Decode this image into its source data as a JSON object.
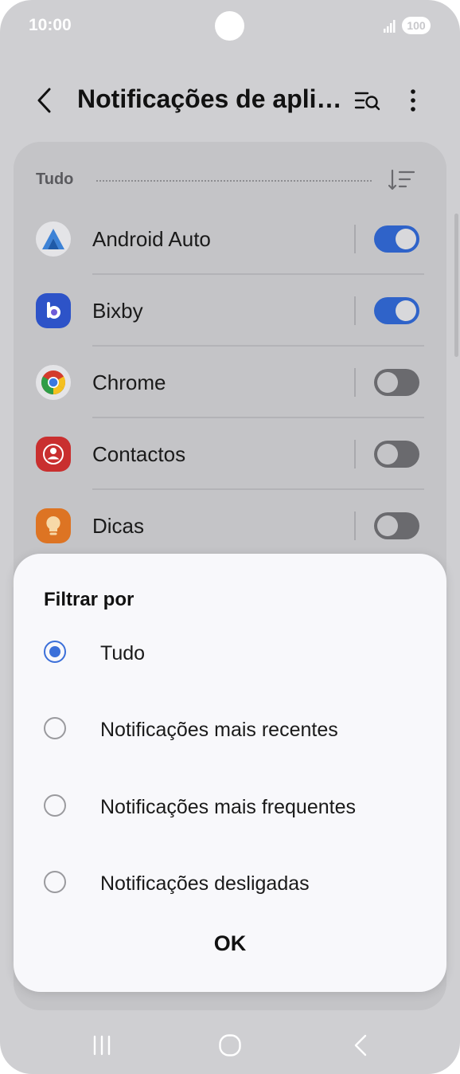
{
  "status_bar": {
    "time": "10:00",
    "battery": "100",
    "signal_icon": "signal-icon"
  },
  "app_bar": {
    "title": "Notificações de aplicações",
    "back_icon": "back-icon",
    "search_icon": "search-filter-icon",
    "more_icon": "more-options-icon"
  },
  "list": {
    "filter_label": "Tudo",
    "sort_icon": "sort-icon",
    "apps": [
      {
        "name": "Android Auto",
        "icon": "android-auto-icon",
        "enabled": true
      },
      {
        "name": "Bixby",
        "icon": "bixby-icon",
        "enabled": true
      },
      {
        "name": "Chrome",
        "icon": "chrome-icon",
        "enabled": false
      },
      {
        "name": "Contactos",
        "icon": "contacts-icon",
        "enabled": false
      },
      {
        "name": "Dicas",
        "icon": "tips-icon",
        "enabled": false
      }
    ]
  },
  "dialog": {
    "title": "Filtrar por",
    "options": [
      {
        "label": "Tudo",
        "selected": true
      },
      {
        "label": "Notificações mais recentes",
        "selected": false
      },
      {
        "label": "Notificações mais frequentes",
        "selected": false
      },
      {
        "label": "Notificações desligadas",
        "selected": false
      }
    ],
    "ok_label": "OK"
  },
  "nav_bar": {
    "recents_icon": "recents-icon",
    "home_icon": "home-icon",
    "back_icon": "nav-back-icon"
  },
  "colors": {
    "accent": "#3b6fd9",
    "toggle_on": "#2f63c9",
    "toggle_off": "#6a6a6e",
    "scrim_background": "#cfcfd2",
    "dialog_background": "#f8f8fb"
  }
}
